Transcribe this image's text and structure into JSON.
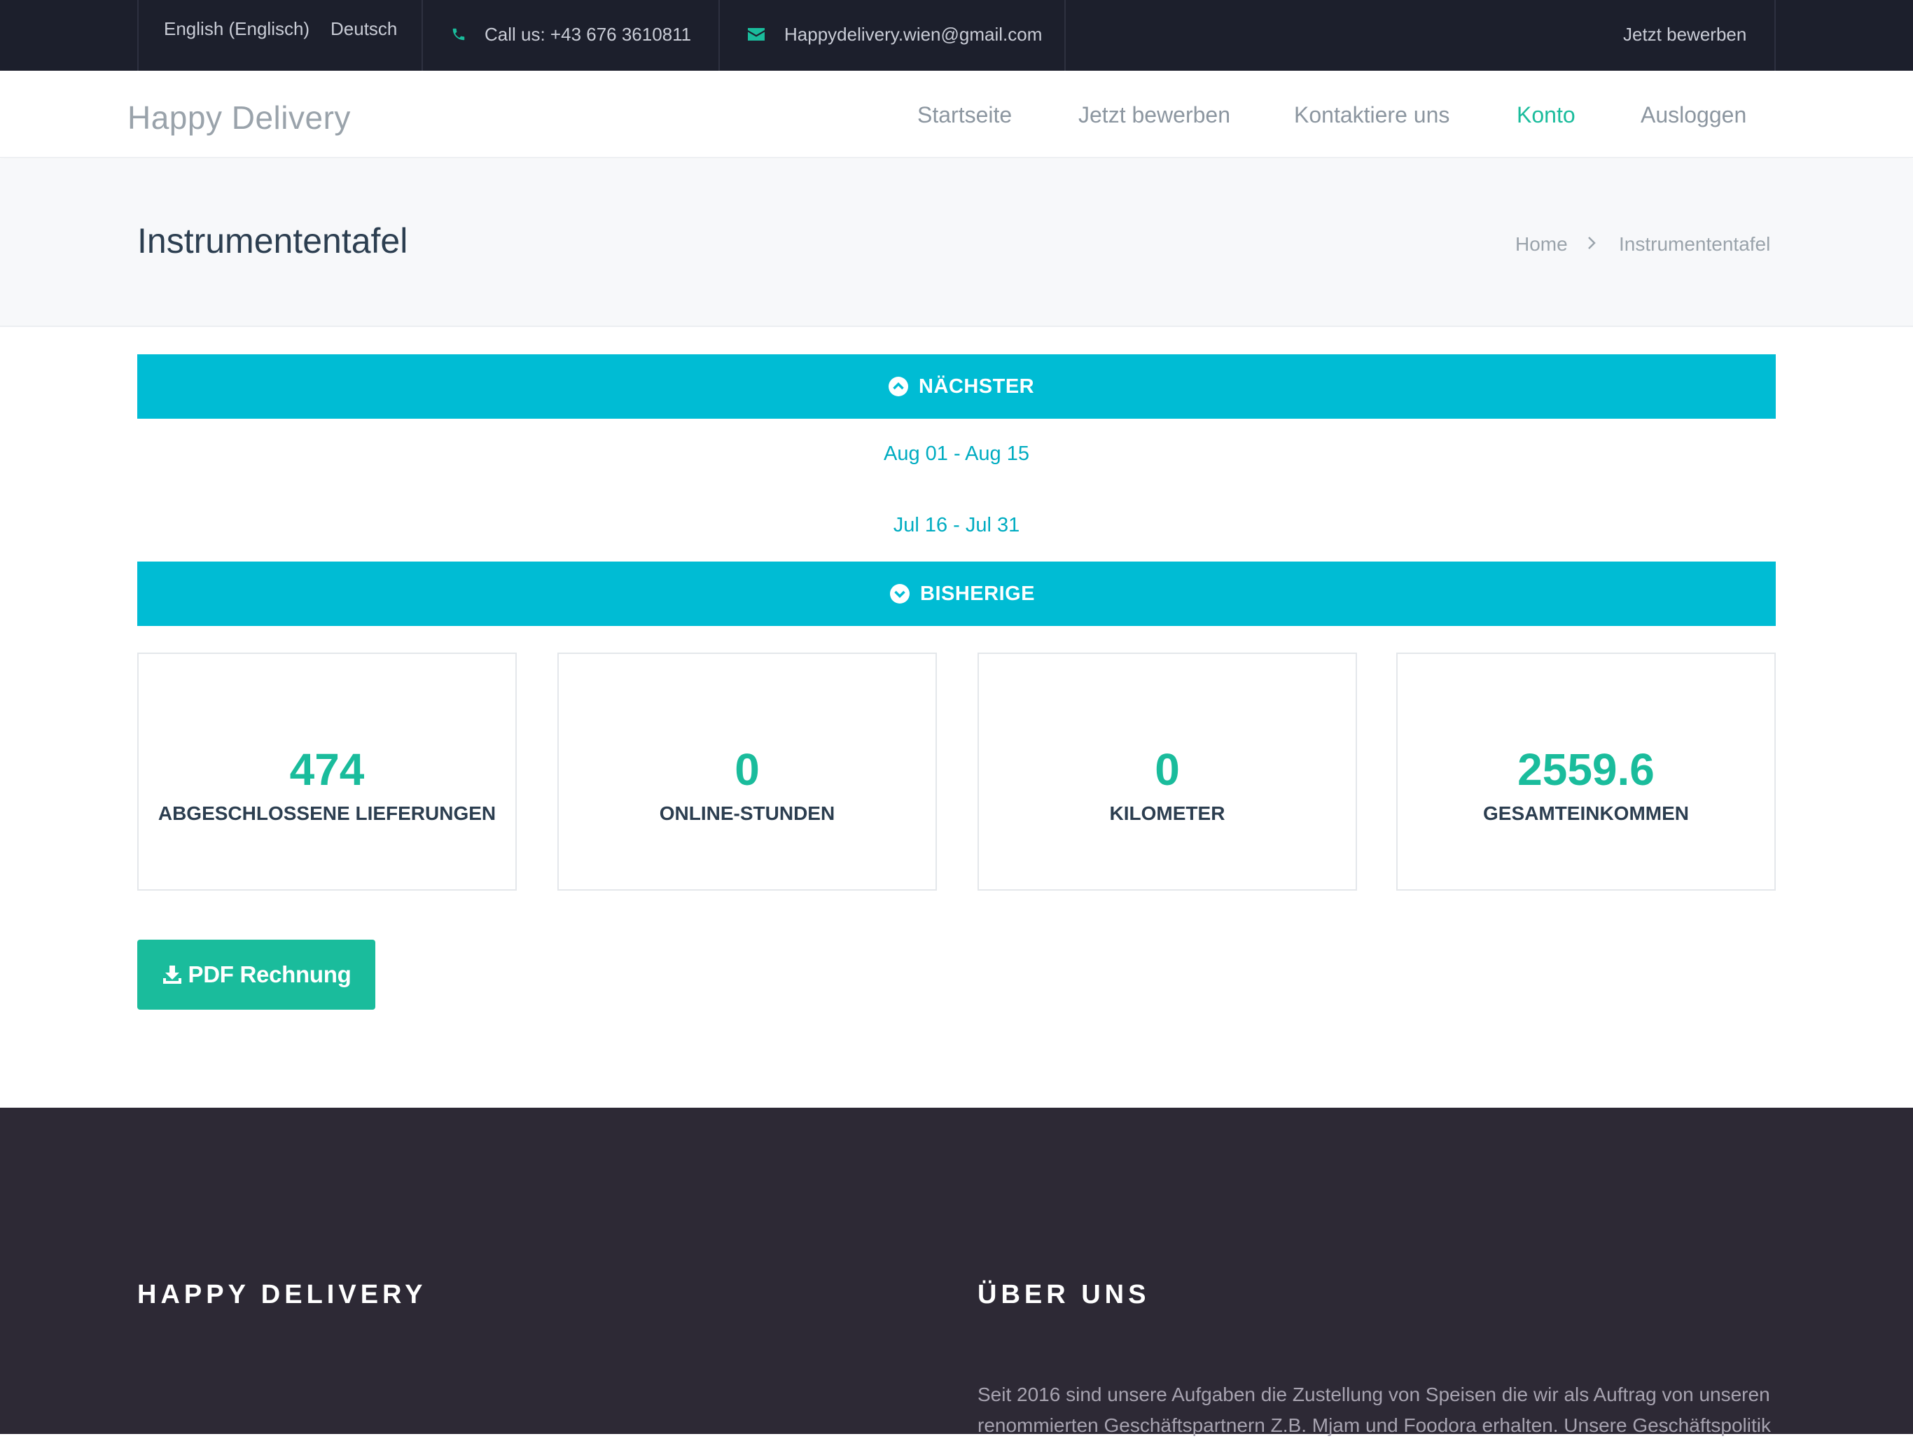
{
  "topbar": {
    "lang_english": "English (Englisch)",
    "lang_german": "Deutsch",
    "phone": "Call us: +43 676 3610811",
    "email": "Happydelivery.wien@gmail.com",
    "apply": "Jetzt bewerben",
    "icons": {
      "phone": "phone-icon",
      "email": "envelope-icon"
    }
  },
  "nav": {
    "logo": "Happy Delivery",
    "items": [
      {
        "label": "Startseite"
      },
      {
        "label": "Jetzt bewerben"
      },
      {
        "label": "Kontaktiere uns"
      },
      {
        "label": "Konto",
        "active": true
      },
      {
        "label": "Ausloggen"
      }
    ]
  },
  "page": {
    "title": "Instrumententafel",
    "breadcrumb": [
      "Home",
      "Instrumententafel"
    ]
  },
  "accordion": {
    "next_label": "NÄCHSTER",
    "previous_label": "BISHERIGE",
    "periods": [
      "Aug 01 - Aug 15",
      "Jul 16 - Jul 31"
    ]
  },
  "stats": [
    {
      "value": "474",
      "label": "ABGESCHLOSSENE LIEFERUNGEN"
    },
    {
      "value": "0",
      "label": "ONLINE-STUNDEN"
    },
    {
      "value": "0",
      "label": "KILOMETER"
    },
    {
      "value": "2559.6",
      "label": "GESAMTEINKOMMEN"
    }
  ],
  "pdf_button": {
    "label": "PDF Rechnung",
    "icon": "download-icon"
  },
  "footer": {
    "col1_heading": "HAPPY DELIVERY",
    "col2_heading": "ÜBER UNS",
    "about_text": "Seit 2016 sind unsere Aufgaben die Zustellung von Speisen die wir als Auftrag von unseren renommierten Geschäftspartnern Z.B. Mjam und Foodora erhalten. Unsere Geschäftspolitik"
  },
  "colors": {
    "topbar_bg": "#1c1f2c",
    "accent_green": "#1abc9c",
    "accordion_cyan": "#00bcd4",
    "footer_bg": "#2d2935"
  }
}
